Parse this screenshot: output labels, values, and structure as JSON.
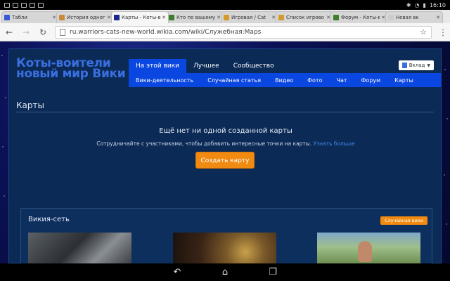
{
  "status": {
    "time": "16:10"
  },
  "tabs": [
    {
      "label": "Табли",
      "favicon_color": "#3b5bd6"
    },
    {
      "label": "История одног",
      "favicon_color": "#c98a3b"
    },
    {
      "label": "Карты - Коты-в",
      "favicon_color": "#1b2a8a",
      "active": true
    },
    {
      "label": "Кто по вашему",
      "favicon_color": "#3e7d2a"
    },
    {
      "label": "Игровая / Cat",
      "favicon_color": "#d49a2a"
    },
    {
      "label": "Список игрово",
      "favicon_color": "#d49a2a"
    },
    {
      "label": "Форум - Коты-в",
      "favicon_color": "#3e7d2a"
    },
    {
      "label": "Новая вк",
      "favicon_color": "#cccccc"
    }
  ],
  "toolbar": {
    "url": "ru.warriors-cats-new-world.wikia.com/wiki/Служебная:Maps"
  },
  "wiki": {
    "wordmark": [
      "Коты-воители",
      "новый мир Вики"
    ],
    "nav": [
      {
        "label": "На этой вики",
        "active": true
      },
      {
        "label": "Лучшее"
      },
      {
        "label": "Сообщество"
      }
    ],
    "subnav": [
      "Вики-деятельность",
      "Случайная статья",
      "Видео",
      "Фото",
      "Чат",
      "Форум",
      "Карты"
    ],
    "contribute": "Вклад"
  },
  "main": {
    "title": "Карты",
    "empty_title": "Ещё нет ни одной созданной карты",
    "empty_desc": "Сотрудничайте с участниками, чтобы добавить интересные точки на карты.",
    "learn_more": "Узнать больше",
    "create_button": "Создать карту"
  },
  "network": {
    "title": "Викия-сеть",
    "random_button": "Случайная вики"
  },
  "colors": {
    "accent": "#0a46e0",
    "button": "#f08a11",
    "wiki_bg": "#0b2a55"
  }
}
